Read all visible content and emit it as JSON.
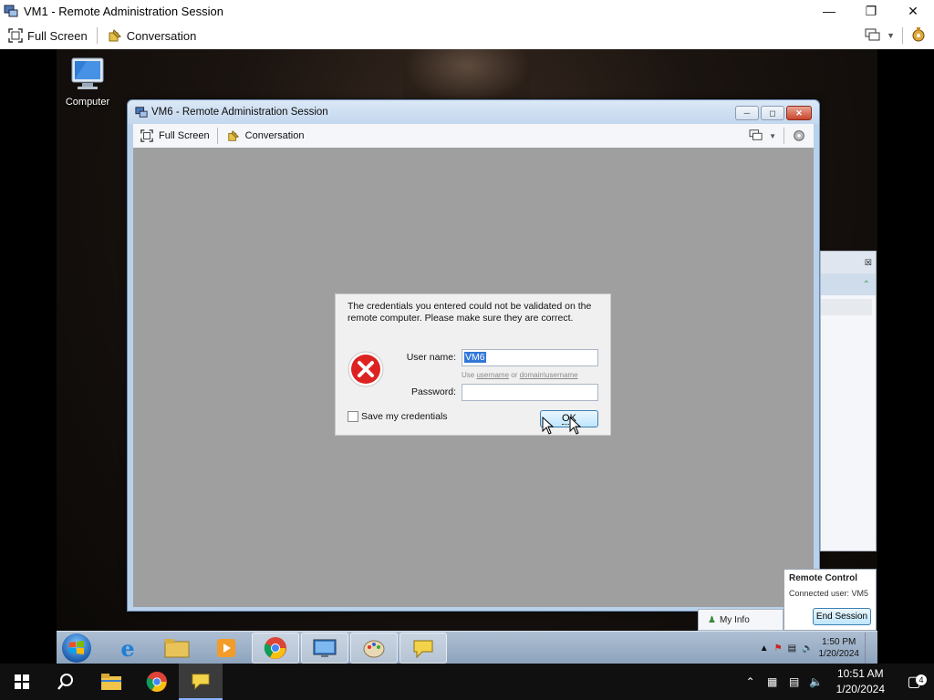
{
  "outer_window": {
    "title": "VM1 - Remote Administration Session",
    "toolbar": {
      "fullscreen_label": "Full Screen",
      "conversation_label": "Conversation"
    }
  },
  "desktop": {
    "computer_icon_label": "Computer"
  },
  "inner_window": {
    "title": "VM6 - Remote Administration Session",
    "toolbar": {
      "fullscreen_label": "Full Screen",
      "conversation_label": "Conversation"
    }
  },
  "dialog": {
    "message": "The credentials you entered could not be validated on the remote computer. Please make sure they are correct.",
    "username_label": "User name:",
    "username_value": "VM6",
    "hint_prefix": "Use ",
    "hint_link1": "username",
    "hint_mid": " or ",
    "hint_link2": "domain\\username",
    "password_label": "Password:",
    "password_value": "",
    "save_credentials_label": "Save my credentials",
    "save_credentials_checked": false,
    "ok_label": "OK"
  },
  "remote_control_popup": {
    "title": "Remote Control",
    "connected_user": "Connected user: VM5",
    "end_session_label": "End Session"
  },
  "my_info_label": "My Info",
  "inner_taskbar": {
    "time": "1:50 PM",
    "date": "1/20/2024"
  },
  "host_taskbar": {
    "time": "10:51 AM",
    "date": "1/20/2024",
    "notification_count": "4"
  },
  "colors": {
    "host_taskbar": "#101010",
    "selection": "#3377d9",
    "inner_body": "#9f9f9f"
  }
}
